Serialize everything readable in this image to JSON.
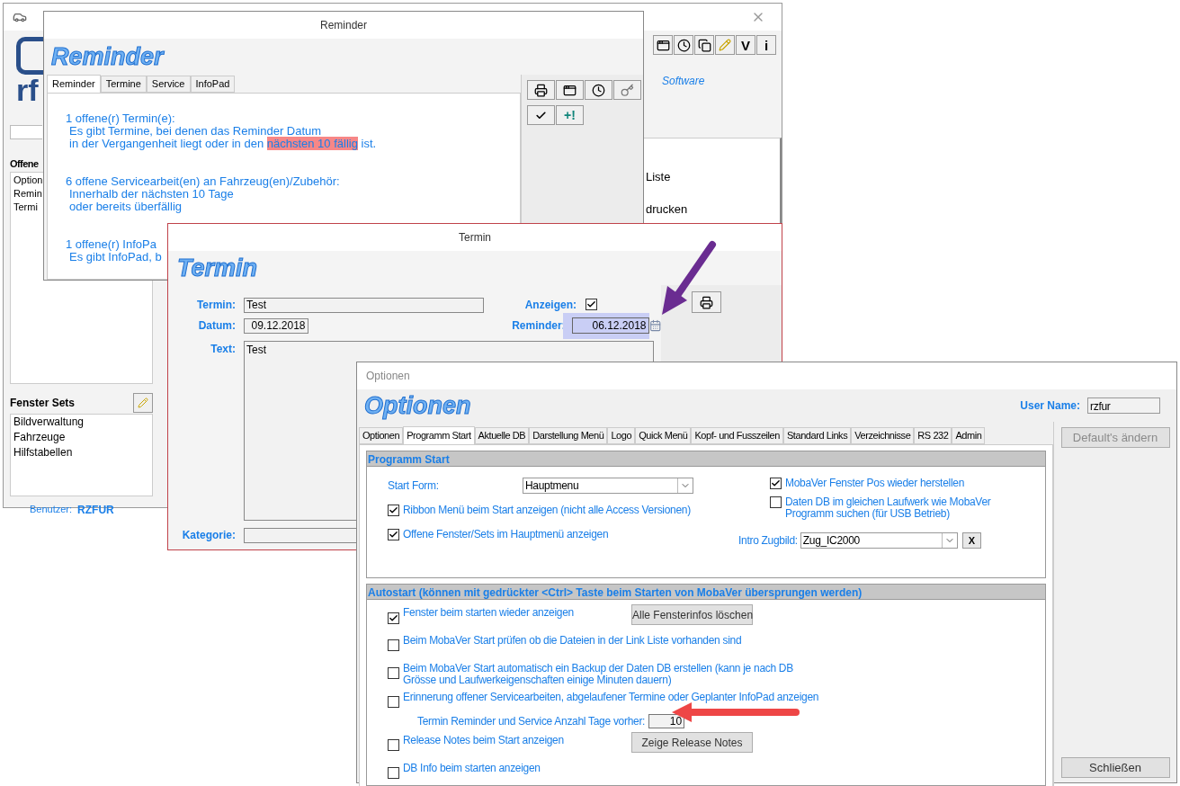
{
  "main_window": {
    "logo_text": "rf",
    "tagline": "Software",
    "toolbar_text_buttons": [
      "V",
      "i"
    ],
    "open_list": {
      "title": "Offene",
      "items": [
        "Option",
        "Remin",
        "Termi"
      ]
    },
    "window_sets": {
      "title": "Fenster Sets",
      "items": [
        "Bildverwaltung",
        "Fahrzeuge",
        "Hilfstabellen"
      ]
    },
    "user": {
      "label": "Benutzer:",
      "value": "RZFUR"
    },
    "panel_items": [
      "Liste",
      "drucken"
    ]
  },
  "reminder_window": {
    "title": "Reminder",
    "heading": "Reminder",
    "tabs": [
      {
        "label": "Reminder",
        "selected": true
      },
      {
        "label": "Termine",
        "selected": false
      },
      {
        "label": "Service",
        "selected": false
      },
      {
        "label": "InfoPad",
        "selected": false
      }
    ],
    "text_buttons": [
      "+!"
    ],
    "messages": [
      {
        "heading": "1 offene(r) Termin(e):",
        "lines": [
          {
            "kind": "plain",
            "text": "Es gibt Termine, bei denen das Reminder Datum"
          },
          {
            "kind": "highlighted",
            "before": "in der Vergangenheit liegt oder in den ",
            "mark": "nächsten 10 fällig",
            "after": " ist."
          }
        ]
      },
      {
        "heading": "6 offene Servicearbeit(en) an Fahrzeug(en)/Zubehör:",
        "lines": [
          {
            "kind": "plain",
            "text": "Innerhalb der nächsten 10 Tage"
          },
          {
            "kind": "plain",
            "text": "oder bereits überfällig"
          }
        ]
      },
      {
        "heading": "1 offene(r) InfoPa",
        "lines": [
          {
            "kind": "plain",
            "text": "Es gibt InfoPad, b"
          }
        ]
      }
    ]
  },
  "termin_window": {
    "title": "Termin",
    "heading": "Termin",
    "termin": {
      "label": "Termin:",
      "value": "Test"
    },
    "datum": {
      "label": "Datum:",
      "value": "09.12.2018"
    },
    "anzeigen": {
      "label": "Anzeigen:",
      "checked": true
    },
    "reminder": {
      "label": "Reminder:",
      "value": "06.12.2018",
      "focused": true
    },
    "text": {
      "label": "Text:",
      "value": "Test"
    },
    "kategorie": {
      "label": "Kategorie:"
    }
  },
  "options_window": {
    "title": "Optionen",
    "heading": "Optionen",
    "user_name": {
      "label": "User Name:",
      "value": "rzfur"
    },
    "tabs": [
      {
        "label": "Optionen",
        "selected": false
      },
      {
        "label": "Programm Start",
        "selected": true
      },
      {
        "label": "Aktuelle DB",
        "selected": false
      },
      {
        "label": "Darstellung Menü",
        "selected": false
      },
      {
        "label": "Logo",
        "selected": false
      },
      {
        "label": "Quick Menü",
        "selected": false
      },
      {
        "label": "Kopf- und Fusszeilen",
        "selected": false
      },
      {
        "label": "Standard Links",
        "selected": false
      },
      {
        "label": "Verzeichnisse",
        "selected": false
      },
      {
        "label": "RS 232",
        "selected": false
      },
      {
        "label": "Admin",
        "selected": false
      }
    ],
    "side_buttons": [
      {
        "label": "Default's ändern",
        "disabled": true
      },
      {
        "label": "Schließen",
        "disabled": false
      }
    ],
    "program_start": {
      "title": "Programm Start",
      "start_form": {
        "label": "Start Form:",
        "value": "Hauptmenu"
      },
      "left_checks": [
        {
          "label": "Ribbon Menü beim Start anzeigen (nicht alle Access Versionen)",
          "checked": true
        },
        {
          "label": "Offene Fenster/Sets im Hauptmenü anzeigen",
          "checked": true
        }
      ],
      "right_checks": [
        {
          "label": "MobaVer Fenster Pos wieder herstellen",
          "checked": true
        },
        {
          "label": "Daten DB im gleichen Laufwerk wie MobaVer Programm suchen (für USB Betrieb)",
          "checked": false
        }
      ],
      "intro": {
        "label": "Intro Zugbild:",
        "value": "Zug_IC2000",
        "clear_button": "X"
      }
    },
    "autostart": {
      "title": "Autostart (können mit gedrückter <Ctrl> Taste beim Starten von MobaVer übersprungen werden)",
      "rows": [
        {
          "kind": "checkbox",
          "label": "Fenster beim starten wieder anzeigen",
          "checked": true,
          "button": "Alle Fensterinfos löschen"
        },
        {
          "kind": "checkbox",
          "label": "Beim MobaVer Start prüfen ob die Dateien in der Link Liste vorhanden sind",
          "checked": false
        },
        {
          "kind": "checkbox",
          "label": "Beim MobaVer Start automatisch ein Backup der Daten DB erstellen (kann je nach DB Grösse und Laufwerkeigenschaften einige Minuten dauern)",
          "checked": false
        },
        {
          "kind": "checkbox",
          "label": "Erinnerung offener Servicearbeiten, abgelaufener Termine oder Geplanter InfoPad anzeigen",
          "checked": false
        },
        {
          "kind": "number",
          "label": "Termin Reminder und Service Anzahl Tage vorher:",
          "value": "10"
        },
        {
          "kind": "checkbox",
          "label": "Release Notes beim Start anzeigen",
          "checked": false,
          "button": "Zeige Release Notes"
        },
        {
          "kind": "checkbox",
          "label": "DB Info beim starten anzeigen",
          "checked": false
        }
      ]
    }
  }
}
